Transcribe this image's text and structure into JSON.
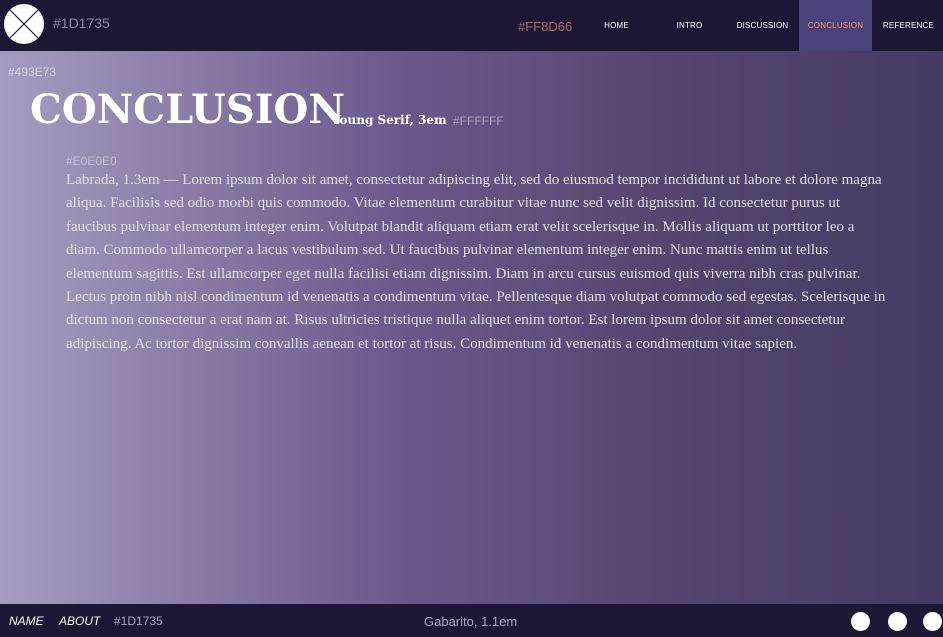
{
  "header": {
    "logo_icon": "x-circle-icon",
    "bar_hex": "#1D1735",
    "accent_hex": "#FF8D66",
    "nav": [
      {
        "label": "HOME"
      },
      {
        "label": "INTRO"
      },
      {
        "label": "DISCUSSION"
      },
      {
        "label": "CONCLUSION",
        "active": true
      },
      {
        "label": "REFERENCE"
      }
    ]
  },
  "main": {
    "panel_hex": "#493E73",
    "title": "CONCLUSION",
    "title_note": "Young Serif, 3em",
    "title_hex": "#FFFFFF",
    "body_hex": "#E0E0E0",
    "body": "Labrada, 1.3em — Lorem ipsum dolor sit amet, consectetur adipiscing elit, sed do eiusmod tempor incididunt ut labore et dolore magna aliqua. Facilisis sed odio morbi quis commodo. Vitae elementum curabitur vitae nunc sed velit dignissim. Id consectetur purus ut faucibus pulvinar elementum integer enim. Volutpat blandit aliquam etiam erat velit scelerisque in. Mollis aliquam ut porttitor leo a diam. Commodo ullamcorper a lacus vestibulum sed. Ut faucibus pulvinar elementum integer enim. Nunc mattis enim ut tellus elementum sagittis. Est ullamcorper eget nulla facilisi etiam dignissim. Diam in arcu cursus euismod quis viverra nibh cras pulvinar. Lectus proin nibh nisl condimentum id venenatis a condimentum vitae. Pellentesque diam volutpat commodo sed egestas. Scelerisque in dictum non consectetur a erat nam at. Risus ultricies tristique nulla aliquet enim tortor. Est lorem ipsum dolor sit amet consectetur adipiscing. Ac tortor dignissim convallis aenean et tortor at risus. Condimentum id venenatis a condimentum vitae sapien."
  },
  "footer": {
    "name_link": "NAME",
    "about_link": "ABOUT",
    "hex": "#1D1735",
    "font_note": "Gabarito, 1.1em",
    "circle_icons": [
      "circle-icon",
      "circle-icon",
      "circle-icon"
    ]
  },
  "colors": {
    "bar": "#1D1735",
    "accent": "#FF8D66",
    "panel": "#493E73",
    "title": "#FFFFFF",
    "body_text": "#E0E0E0"
  }
}
